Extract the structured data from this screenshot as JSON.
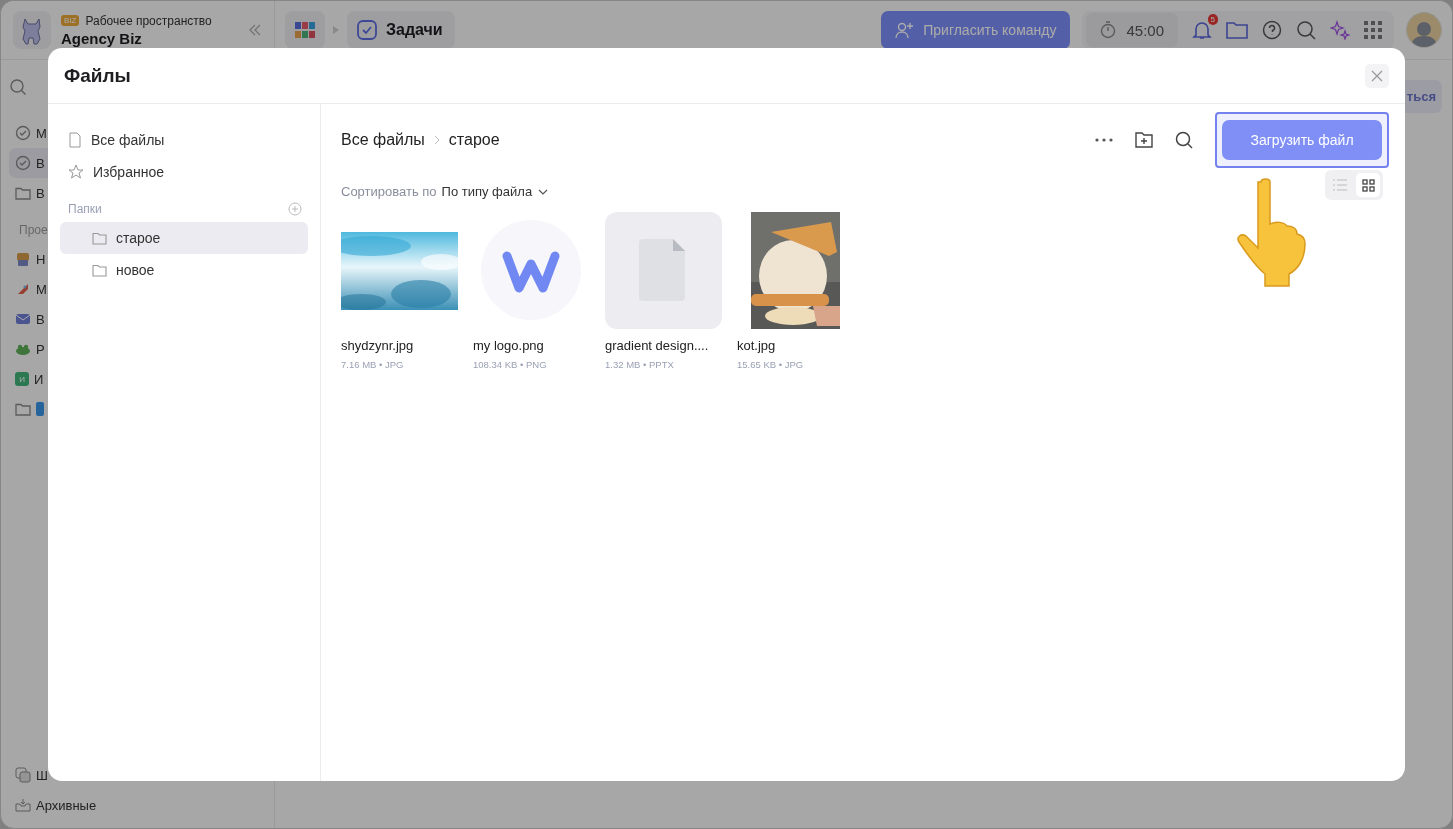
{
  "app": {
    "workspace_badge": "BIZ",
    "workspace_label": "Рабочее пространство",
    "workspace_name": "Agency Biz",
    "tab": "Задачи",
    "invite_button": "Пригласить команду",
    "timer": "45:00",
    "notification_count": "5",
    "side_button": "ться"
  },
  "sidebar": {
    "items": [
      {
        "label": "М",
        "kind": "check",
        "selected": false
      },
      {
        "label": "В",
        "kind": "check",
        "selected": true
      },
      {
        "label": "В",
        "kind": "folder",
        "selected": false
      }
    ],
    "section": "Прое",
    "projects": [
      {
        "label": "Н",
        "kind": "robot"
      },
      {
        "label": "М",
        "kind": "rocket"
      },
      {
        "label": "В",
        "kind": "mail"
      },
      {
        "label": "Р",
        "kind": "frog"
      },
      {
        "label": "И",
        "kind": "letter",
        "badge": "И"
      },
      {
        "kind": "folder-tag"
      }
    ],
    "bottom": [
      {
        "label": "Ш",
        "kind": "layers"
      },
      {
        "label": "Архивные",
        "kind": "archive"
      }
    ]
  },
  "modal": {
    "title": "Файлы",
    "nav": [
      {
        "label": "Все файлы",
        "kind": "file"
      },
      {
        "label": "Избранное",
        "kind": "star"
      }
    ],
    "folders_heading": "Папки",
    "folders": [
      {
        "label": "старое",
        "selected": true
      },
      {
        "label": "новое",
        "selected": false
      }
    ],
    "breadcrumb": [
      "Все файлы",
      "старое"
    ],
    "sort_label": "Сортировать по",
    "sort_value": "По типу файла",
    "upload_button": "Загрузить файл",
    "upload_focused": true,
    "views": [
      {
        "kind": "list",
        "selected": false
      },
      {
        "kind": "grid",
        "selected": true
      }
    ],
    "files": [
      {
        "name": "shydzynr.jpg",
        "meta": "7.16 MB • JPG",
        "kind": "photo-blue"
      },
      {
        "name": "my logo.png",
        "meta": "108.34 KB • PNG",
        "kind": "logo"
      },
      {
        "name": "gradient design....",
        "meta": "1.32 MB • PPTX",
        "kind": "document"
      },
      {
        "name": "kot.jpg",
        "meta": "15.65 KB • JPG",
        "kind": "photo-cat"
      }
    ]
  }
}
